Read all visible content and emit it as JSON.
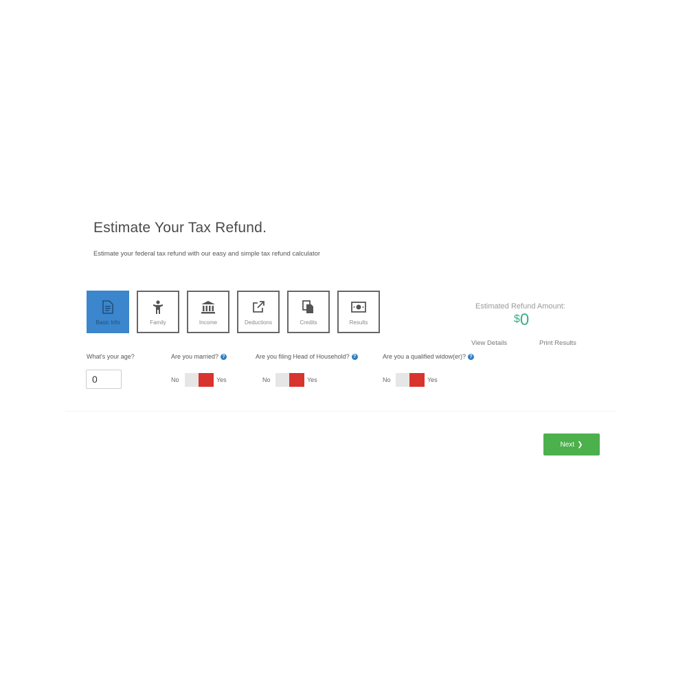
{
  "header": {
    "title": "Estimate Your Tax Refund.",
    "subtitle": "Estimate your federal tax refund with our easy and simple tax refund calculator"
  },
  "steps": [
    {
      "label": "Basic Info",
      "icon": "document-icon",
      "active": true
    },
    {
      "label": "Family",
      "icon": "person-icon",
      "active": false
    },
    {
      "label": "Income",
      "icon": "bank-icon",
      "active": false
    },
    {
      "label": "Deductions",
      "icon": "external-link-icon",
      "active": false
    },
    {
      "label": "Credits",
      "icon": "copy-icon",
      "active": false
    },
    {
      "label": "Results",
      "icon": "money-icon",
      "active": false
    }
  ],
  "refund": {
    "label": "Estimated Refund Amount:",
    "currency": "$",
    "amount": "0",
    "view_details": "View Details",
    "print_results": "Print Results"
  },
  "questions": {
    "age": {
      "label": "What's your age?",
      "value": "0"
    },
    "married": {
      "label": "Are you married?",
      "no": "No",
      "yes": "Yes"
    },
    "head_of_household": {
      "label": "Are you filing Head of Household?",
      "no": "No",
      "yes": "Yes"
    },
    "widow": {
      "label": "Are you a qualified widow(er)?",
      "no": "No",
      "yes": "Yes"
    }
  },
  "help_glyph": "?",
  "next": {
    "label": "Next",
    "arrow": "❯"
  },
  "colors": {
    "active_step": "#3b86cc",
    "refund_amount": "#3ab08c",
    "toggle_knob": "#d9332d",
    "next_button": "#4cb04c",
    "help_icon": "#2f7fc4"
  }
}
